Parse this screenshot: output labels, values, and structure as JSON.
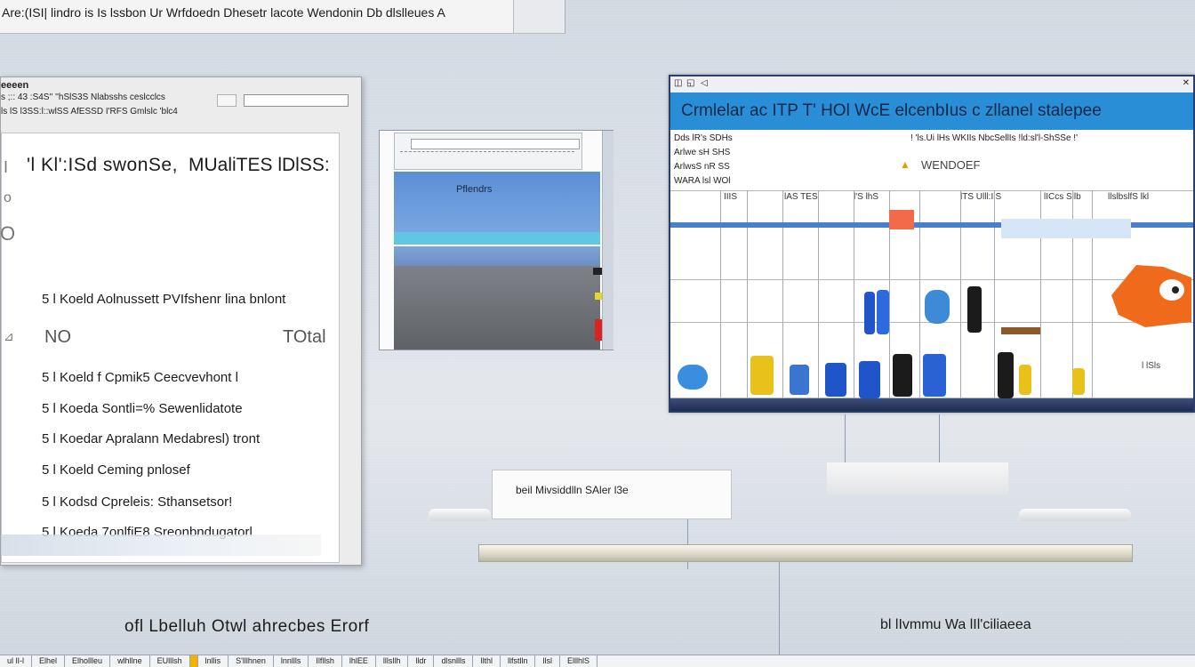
{
  "top_bar": {
    "title": "Are:(ISI| lindro is Is lssbon Ur Wrfdoedn Dhesetr lacote Wendonin Db dlslleues A"
  },
  "left_dialog": {
    "title": "eeeen",
    "line1": "s  ;:: 43  :S4S'' ''hSlS3S  Nlabsshs ceslcclcs",
    "line2": "ls lS  l3SS:l::wlSS AfESSD I'RFS Gmlslc 'blc4",
    "search_placeholder": "",
    "heading": "'l Kl':ISd swonSe,",
    "heading_right": "MUaliTES  lDlSS:",
    "no_label": "NO",
    "total_label": "TOtal",
    "items": [
      "5 l Koeld Aolnussett PVIfshenr lina bnlont",
      "5 l Koeld f Cpmik5 Ceecvevhont l",
      "5 l Koeda Sontli=% Sewenlidatote",
      "5 l Koedar Apralann Medabresl) tront",
      "5 l Koeld Ceming pnlosef",
      "5 l Kodsd Cpreleis: Sthansetsor!",
      "5 l Koeda 7onlfiE8 Sreonbndugatorl"
    ]
  },
  "mid_window": {
    "label": "Pflendrs"
  },
  "right_window": {
    "header": "Crmlelar ac ITP  T'  HOl WcE elcenbIus  c  zllanel stalepee",
    "left_lines": [
      "Dds lR's SDHs",
      "Arlwe sH SHS",
      "ArlwsS nR SS",
      "WARA lsl WOl"
    ],
    "top_line": "! 'ls.Ui lHs WKIIs NbcSellIs !ld:sl'l-ShSSe !' ",
    "warn_text": "WENDOEF",
    "col_heads": [
      "IIIS",
      "lAS TES",
      "l'S  lhS",
      "lTS  Ulll:IlS",
      "lICcs  Sllb",
      "llslbslfS lkl"
    ],
    "corner_label": "l lSls"
  },
  "center_box": {
    "text": "beil Mivsiddlln SAler l3e"
  },
  "bottom_captions": {
    "left": "ofl Lbelluh Otwl ahrecbes Erorf",
    "right": "bl lIvmmu Wa lIl'ciliaeea"
  },
  "taskbar": {
    "items": [
      "ul lI-l",
      "Elhel",
      "Elhollleu",
      "wlhllne",
      "EUlllsh",
      "",
      "lnllis",
      "S'lllhnen",
      "lnnllls",
      "Ilfllsh",
      "lhlEE",
      "lllsllh",
      "lldr",
      "dlsnllls",
      "llthl",
      "llfstlln",
      "llsl",
      "ElllhlS"
    ]
  },
  "colors": {
    "header_blue": "#2a8ed6",
    "taskbar_active": "#f0b400",
    "accent_orange": "#f06a1c"
  }
}
